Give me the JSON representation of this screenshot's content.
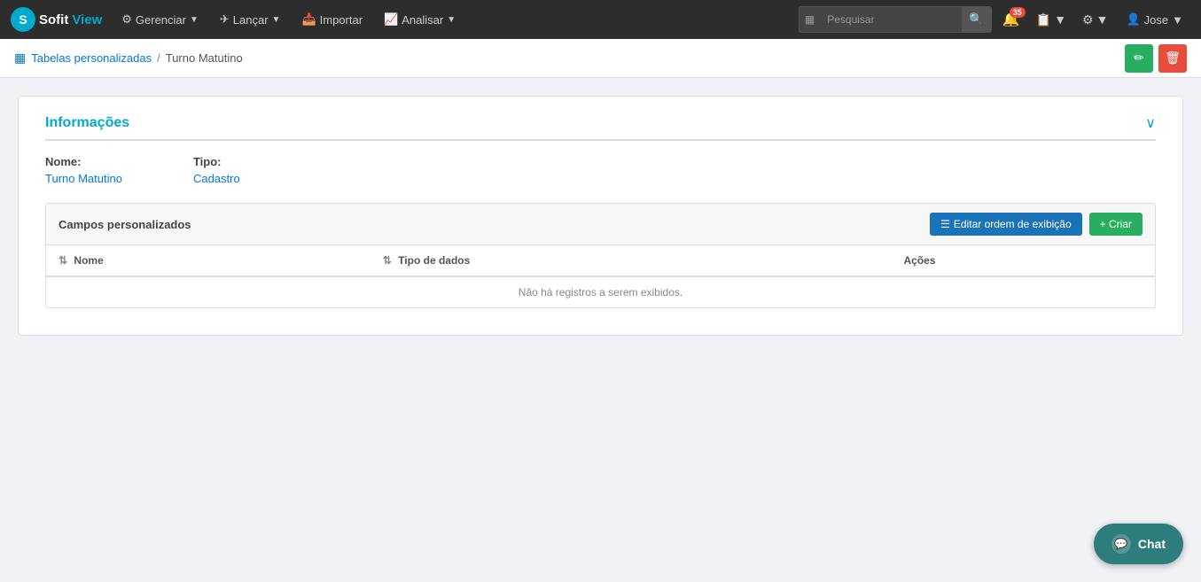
{
  "brand": {
    "sofit": "Sofit",
    "view": "View"
  },
  "navbar": {
    "items": [
      {
        "label": "Gerenciar",
        "icon": "⚙",
        "hasDropdown": true
      },
      {
        "label": "Lançar",
        "icon": "✈",
        "hasDropdown": true
      },
      {
        "label": "Importar",
        "icon": "📥",
        "hasDropdown": false
      },
      {
        "label": "Analisar",
        "icon": "📈",
        "hasDropdown": true
      }
    ],
    "search_placeholder": "Pesquisar",
    "notification_count": "35",
    "user_name": "Jose"
  },
  "breadcrumb": {
    "link_label": "Tabelas personalizadas",
    "separator": "/",
    "current": "Turno Matutino"
  },
  "info_section": {
    "title": "Informações",
    "fields": {
      "name_label": "Nome:",
      "name_value": "Turno Matutino",
      "type_label": "Tipo:",
      "type_value": "Cadastro"
    }
  },
  "campos_section": {
    "title": "Campos personalizados",
    "btn_order": "Editar ordem de exibição",
    "btn_create": "+ Criar",
    "table": {
      "columns": [
        {
          "label": "Nome",
          "sortable": true
        },
        {
          "label": "Tipo de dados",
          "sortable": true
        },
        {
          "label": "Ações",
          "sortable": false
        }
      ],
      "empty_message": "Não há registros a serem exibidos."
    }
  },
  "chat": {
    "label": "Chat"
  }
}
